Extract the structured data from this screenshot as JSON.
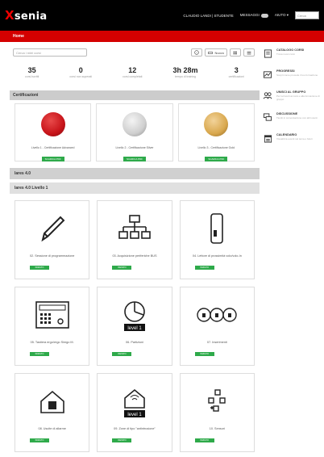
{
  "header": {
    "logo": "senia",
    "logo_mark": "X",
    "user": "CLAUDIO LANDI | STUDENTE",
    "messages": "MESSAGGI",
    "help": "AIUTO",
    "search_placeholder": "Cerca"
  },
  "breadcrumb": "Home",
  "toolbar": {
    "search_placeholder": "Cerca i miei corsi",
    "info_icon": "i",
    "filter_label": "Nuovo"
  },
  "stats": [
    {
      "value": "35",
      "label": "corsi iscritti"
    },
    {
      "value": "0",
      "label": "corsi non superati"
    },
    {
      "value": "12",
      "label": "corsi completati"
    },
    {
      "value": "3h 28m",
      "label": "tempo di training"
    },
    {
      "value": "3",
      "label": "certificazioni"
    }
  ],
  "certifications": {
    "title": "Certificazioni",
    "items": [
      {
        "label": "Livello 1 - Certificazione Advanced",
        "button": "SCARICA PDF",
        "color": "#c8141a"
      },
      {
        "label": "Livello 2 - Certificazione Silver",
        "button": "SCARICA PDF",
        "color": "#cfcfcf"
      },
      {
        "label": "Livello 3 - Certificazione Gold",
        "button": "SCARICA PDF",
        "color": "#d9a84e"
      }
    ]
  },
  "section1": "lares 4.0",
  "section2": "lares 4.0 Livello 1",
  "courses": [
    {
      "label": "02. Sessione di programmazione",
      "icon": "pencil-icon",
      "status": "INIZIATO"
    },
    {
      "label": "03. Acquisizione periferiche BUS",
      "icon": "network-icon",
      "status": "INIZIATO"
    },
    {
      "label": "04. Lettore di prossimità volo/volo-In",
      "icon": "reader-icon",
      "status": "INIZIATO"
    },
    {
      "label": "05. Tastiera ergo/ergo Simgo M.",
      "icon": "keypad-icon",
      "status": "INIZIATO"
    },
    {
      "label": "06. Partizioni",
      "icon": "partitions-icon",
      "status": "INIZIATO",
      "badge": "level 1"
    },
    {
      "label": "07. Inserimenti",
      "icon": "arming-icon",
      "status": "INIZIATO"
    },
    {
      "label": "08. Uscite di allarme",
      "icon": "alarm-house-icon",
      "status": "INIZIATO"
    },
    {
      "label": "09. Zone di tipo \"antintrusione\"",
      "icon": "zone-house-icon",
      "status": "INIZIATO",
      "badge": "level 1"
    },
    {
      "label": "10. Sensori",
      "icon": "sensors-icon",
      "status": "INIZIATO"
    }
  ],
  "sidebar": [
    {
      "title": "CATALOGO CORSI",
      "desc": "Trova nuovi corsi",
      "icon": "catalog-icon"
    },
    {
      "title": "PROGRESSI",
      "desc": "Scopri come procede il tuo formazione",
      "icon": "progress-icon"
    },
    {
      "title": "UNISCI AL GRUPPO",
      "desc": "Per iscriverti ai corsi e alla formazione di gruppo",
      "icon": "group-icon"
    },
    {
      "title": "DISCUSSIONE",
      "desc": "Tieniti in conversazione con altri utenti",
      "icon": "discussion-icon"
    },
    {
      "title": "CALENDARIO",
      "desc": "Visualizza eventi nel tema o futuri",
      "icon": "calendar-icon"
    }
  ]
}
